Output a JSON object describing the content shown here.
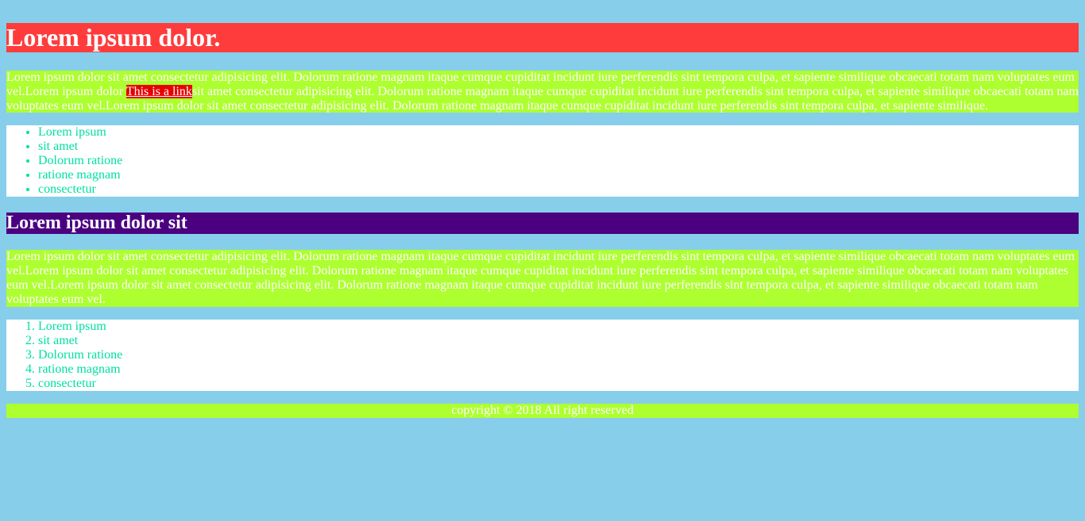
{
  "header": {
    "title": "Lorem ipsum dolor."
  },
  "section1": {
    "paragraph_before_link": "Lorem ipsum dolor sit amet consectetur adipisicing elit. Dolorum ratione magnam itaque cumque cupiditat incidunt iure perferendis sint tempora culpa, et sapiente similique obcaecati totam nam voluptates eum vel.Lorem ipsum dolor ",
    "link_text": "This is a link",
    "paragraph_after_link": "sit amet consectetur adipisicing elit. Dolorum ratione magnam itaque cumque cupiditat incidunt iure perferendis sint tempora culpa, et sapiente similique obcaecati totam nam voluptates eum vel.Lorem ipsum dolor sit amet consectetur adipisicing elit. Dolorum ratione magnam itaque cumque cupiditat incidunt iure perferendis sint tempora culpa, et sapiente similique.",
    "list_items": [
      "Lorem ipsum",
      "sit amet",
      "Dolorum ratione",
      "ratione magnam",
      "consectetur"
    ]
  },
  "section2": {
    "heading": "Lorem ipsum dolor sit",
    "paragraph": "Lorem ipsum dolor sit amet consectetur adipisicing elit. Dolorum ratione magnam itaque cumque cupiditat incidunt iure perferendis sint tempora culpa, et sapiente similique obcaecati totam nam voluptates eum vel.Lorem ipsum dolor sit amet consectetur adipisicing elit. Dolorum ratione magnam itaque cumque cupiditat incidunt iure perferendis sint tempora culpa, et sapiente similique obcaecati totam nam voluptates eum vel.Lorem ipsum dolor sit amet consectetur adipisicing elit. Dolorum ratione magnam itaque cumque cupiditat incidunt iure perferendis sint tempora culpa, et sapiente similique obcaecati totam nam voluptates eum vel.",
    "list_items": [
      "Lorem ipsum",
      "sit amet",
      "Dolorum ratione",
      "ratione magnam",
      "consectetur"
    ]
  },
  "footer": {
    "text": "copyright © 2018 All right reserved"
  },
  "colors": {
    "page_background": "#87ceeb",
    "header_background": "#ff3c3c",
    "paragraph_background": "#adff2f",
    "heading2_background": "#4b0080",
    "link_background": "#e60000",
    "list_text": "#00e0a0"
  }
}
